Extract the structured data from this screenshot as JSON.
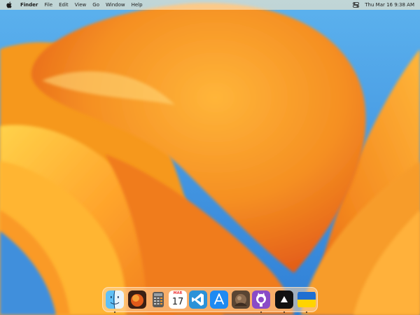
{
  "menubar": {
    "app_name": "Finder",
    "menus": [
      "File",
      "Edit",
      "View",
      "Go",
      "Window",
      "Help"
    ],
    "datetime": "Thu Mar 16  9:38 AM"
  },
  "dock": {
    "apps": [
      {
        "name": "Finder",
        "icon": "finder-icon",
        "running": true
      },
      {
        "name": "macOS Ventura",
        "icon": "wallpaper-app-icon",
        "running": false
      },
      {
        "name": "Calculator",
        "icon": "calculator-icon",
        "running": false
      },
      {
        "name": "Calendar",
        "icon": "calendar-icon",
        "running": false,
        "month": "MAR",
        "day": "17"
      },
      {
        "name": "Visual Studio Code",
        "icon": "vscode-icon",
        "running": false
      },
      {
        "name": "App Store",
        "icon": "app-store-icon",
        "running": false
      },
      {
        "name": "Photo Viewer",
        "icon": "photo-app-icon",
        "running": false
      },
      {
        "name": "GitHub Desktop",
        "icon": "github-desktop-icon",
        "running": true
      },
      {
        "name": "Arc",
        "icon": "triangle-app-icon",
        "running": true
      },
      {
        "name": "Ukraine Flag",
        "icon": "ukraine-flag-icon",
        "running": true
      }
    ]
  },
  "colors": {
    "wallpaper_sky": "#3f95e0",
    "wallpaper_orange": "#f6901f",
    "wallpaper_yellow": "#ffc93a",
    "wallpaper_red": "#e2571a"
  }
}
